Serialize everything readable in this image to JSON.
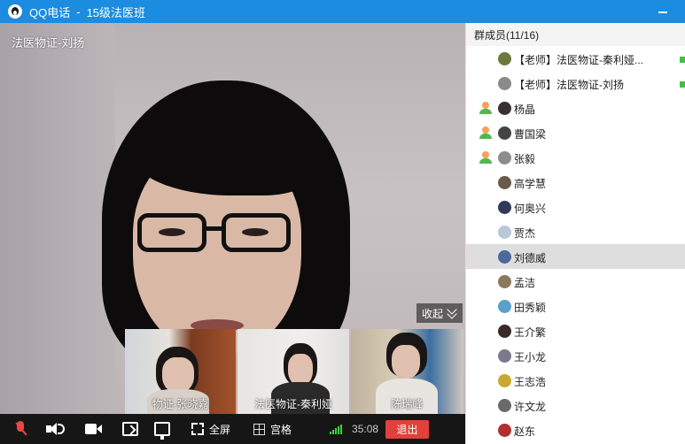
{
  "window": {
    "app_name": "QQ电话",
    "separator": "-",
    "group_name": "15级法医班"
  },
  "main_video": {
    "speaker_name": "法医物证-刘扬",
    "collapse_label": "收起"
  },
  "thumbnails": [
    {
      "name": "物证-张晓嘉"
    },
    {
      "name": "法医物证-秦利娅"
    },
    {
      "name": "陈瑞峰"
    }
  ],
  "toolbar": {
    "fullscreen_label": "全屏",
    "grid_label": "宫格",
    "timer": "35:08",
    "exit_label": "退出"
  },
  "members_panel": {
    "header": "群成员(11/16)",
    "members": [
      {
        "name": "【老师】法医物证-秦利娅...",
        "speaking": false,
        "online": true,
        "avatar_color": "#6b7a3a"
      },
      {
        "name": "【老师】法医物证-刘扬",
        "speaking": false,
        "online": true,
        "avatar_color": "#8a8a8a"
      },
      {
        "name": "杨晶",
        "speaking": true,
        "online": false,
        "avatar_color": "#3a2f35"
      },
      {
        "name": "曹国梁",
        "speaking": true,
        "online": false,
        "avatar_color": "#444444"
      },
      {
        "name": "张毅",
        "speaking": true,
        "online": false,
        "avatar_color": "#8c8c8c"
      },
      {
        "name": "高学慧",
        "speaking": false,
        "online": false,
        "avatar_color": "#6a5a4a"
      },
      {
        "name": "何奥兴",
        "speaking": false,
        "online": false,
        "avatar_color": "#2f3a5a"
      },
      {
        "name": "贾杰",
        "speaking": false,
        "online": false,
        "avatar_color": "#b8c8d8"
      },
      {
        "name": "刘德威",
        "speaking": false,
        "online": false,
        "avatar_color": "#4a6a9a",
        "selected": true
      },
      {
        "name": "孟洁",
        "speaking": false,
        "online": false,
        "avatar_color": "#8a7a5a"
      },
      {
        "name": "田秀颖",
        "speaking": false,
        "online": false,
        "avatar_color": "#5aa0c8"
      },
      {
        "name": "王介繁",
        "speaking": false,
        "online": false,
        "avatar_color": "#3a2a2a"
      },
      {
        "name": "王小龙",
        "speaking": false,
        "online": false,
        "avatar_color": "#7a7a8a"
      },
      {
        "name": "王志浩",
        "speaking": false,
        "online": false,
        "avatar_color": "#c8a830"
      },
      {
        "name": "许文龙",
        "speaking": false,
        "online": false,
        "avatar_color": "#6a6a6a"
      },
      {
        "name": "赵东",
        "speaking": false,
        "online": false,
        "avatar_color": "#b03030"
      }
    ]
  }
}
